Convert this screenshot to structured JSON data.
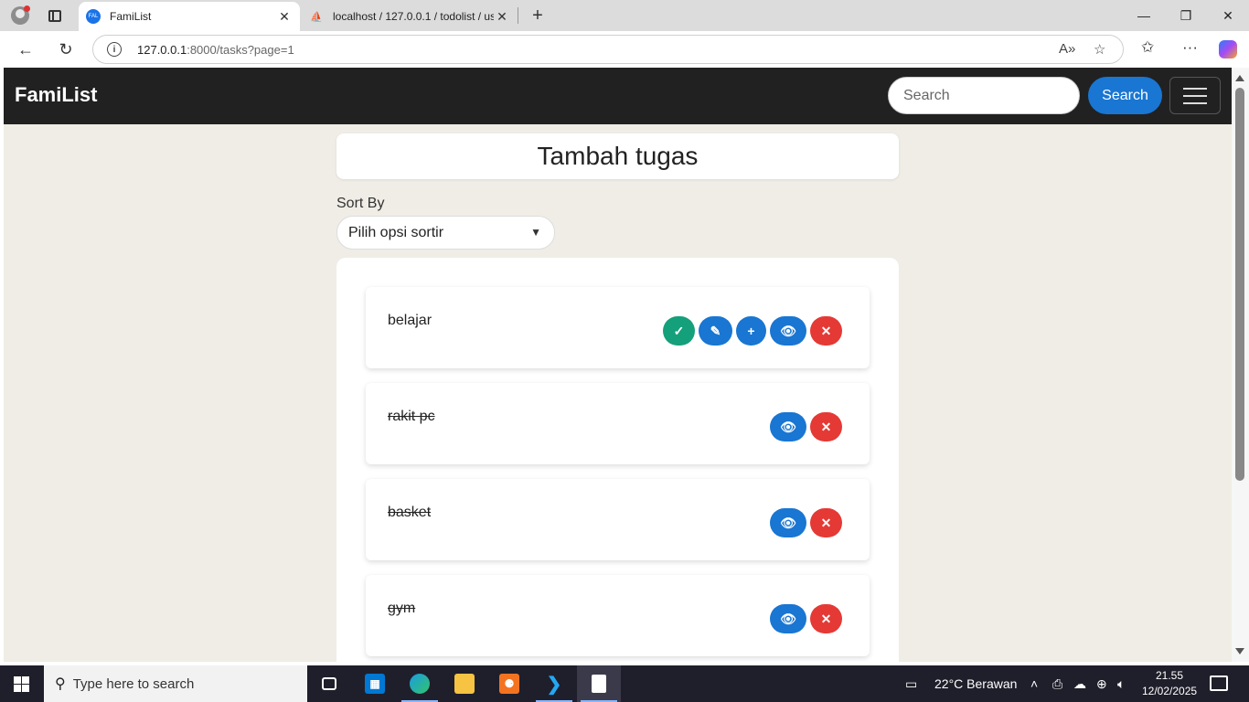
{
  "browser": {
    "tabs": [
      {
        "title": "FamiList",
        "favicon": "FAL",
        "active": true
      },
      {
        "title": "localhost / 127.0.0.1 / todolist / us",
        "favicon": "phpmyadmin",
        "active": false
      }
    ],
    "url_host": "127.0.0.1",
    "url_rest": ":8000/tasks?page=1"
  },
  "navbar": {
    "brand": "FamiList",
    "search_placeholder": "Search",
    "search_button": "Search"
  },
  "main": {
    "heading": "Tambah tugas",
    "sort_label": "Sort By",
    "sort_selected": "Pilih opsi sortir",
    "tasks": [
      {
        "name": "belajar",
        "completed": false,
        "actions": [
          "complete",
          "edit",
          "add",
          "view",
          "delete"
        ]
      },
      {
        "name": "rakit pc",
        "completed": true,
        "actions": [
          "view",
          "delete"
        ]
      },
      {
        "name": "basket",
        "completed": true,
        "actions": [
          "view",
          "delete"
        ]
      },
      {
        "name": "gym",
        "completed": true,
        "actions": [
          "view",
          "delete"
        ]
      }
    ]
  },
  "colors": {
    "navbar_bg": "#212121",
    "page_bg": "#f0ede6",
    "primary": "#1976d2",
    "success": "#14a07a",
    "danger": "#e53935"
  },
  "taskbar": {
    "search_placeholder": "Type here to search",
    "weather": "22°C  Berawan",
    "time": "21.55",
    "date": "12/02/2025"
  }
}
